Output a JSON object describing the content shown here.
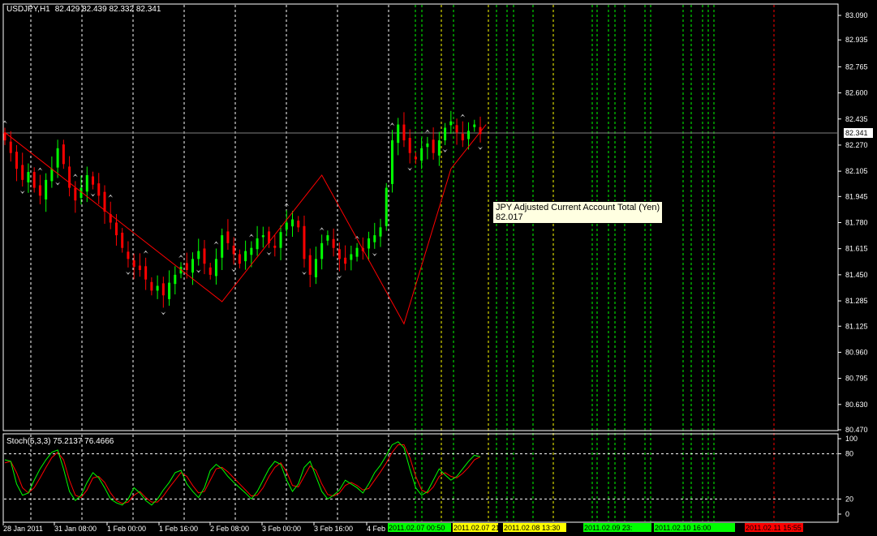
{
  "header": {
    "symbol": "USDJPY,H1",
    "ohlc": "82.429 82.439 82.332 82.341"
  },
  "stoch_header": "Stoch(5,3,3) 75.2137 76.4666",
  "current_price": "82.341",
  "tooltip": {
    "title": "JPY Adjusted Current Account Total (Yen)",
    "value": "82.017"
  },
  "colors": {
    "bull": "#00ff00",
    "bear": "#ff0000",
    "zigzag": "#ff0000",
    "stoch_main": "#00ff00",
    "stoch_signal": "#ff0000",
    "grid": "#ffffff",
    "frame": "#ffffff",
    "background": "#000000"
  },
  "chart_data": {
    "type": "line",
    "price_axis": {
      "labels": [
        "83.090",
        "82.935",
        "82.765",
        "82.600",
        "82.435",
        "82.270",
        "82.105",
        "81.945",
        "81.780",
        "81.615",
        "81.450",
        "81.285",
        "81.125",
        "80.960",
        "80.795",
        "80.630",
        "80.470"
      ],
      "ylim": [
        80.47,
        83.09
      ]
    },
    "stoch_axis": {
      "labels": [
        "100",
        "80",
        "20",
        "0"
      ],
      "ylim": [
        0,
        100
      ]
    },
    "time_labels": [
      "28 Jan 2011",
      "31 Jan 08:00",
      "1 Feb 00:00",
      "1 Feb 16:00",
      "2 Feb 08:00",
      "3 Feb 00:00",
      "3 Feb 16:00",
      "4 Feb"
    ],
    "close_series": [
      82.3,
      82.22,
      82.12,
      82.05,
      82.1,
      82.0,
      81.95,
      82.05,
      82.12,
      82.25,
      82.15,
      82.0,
      81.92,
      82.0,
      82.08,
      82.02,
      81.95,
      81.85,
      81.78,
      81.7,
      81.62,
      81.55,
      81.5,
      81.48,
      81.42,
      81.35,
      81.38,
      81.32,
      81.4,
      81.45,
      81.5,
      81.48,
      81.55,
      81.6,
      81.52,
      81.45,
      81.55,
      81.7,
      81.65,
      81.58,
      81.52,
      81.6,
      81.62,
      81.68,
      81.7,
      81.65,
      81.62,
      81.72,
      81.78,
      81.8,
      81.75,
      81.55,
      81.45,
      81.55,
      81.65,
      81.7,
      81.62,
      81.55,
      81.52,
      81.58,
      81.62,
      81.6,
      81.68,
      81.7,
      81.75,
      82.0,
      82.3,
      82.4,
      82.3,
      82.22,
      82.18,
      82.25,
      82.28,
      82.22,
      82.3,
      82.38,
      82.42,
      82.35,
      82.3,
      82.36,
      82.4,
      82.34
    ],
    "zigzag": [
      [
        0,
        82.35
      ],
      [
        37,
        81.28
      ],
      [
        54,
        82.08
      ],
      [
        68,
        81.14
      ],
      [
        76,
        82.12
      ],
      [
        82,
        82.4
      ]
    ],
    "event_labels": [
      {
        "text": "2011.02.07 00:50",
        "color": "#00ff00"
      },
      {
        "text": "2011.02.07 21:",
        "color": "#ffff00"
      },
      {
        "text": "2011.02.08 13:30",
        "color": "#ffff00"
      },
      {
        "text": "2011.02.09 23:",
        "color": "#00ff00"
      },
      {
        "text": "2011.02.10 16:00",
        "color": "#00ff00"
      },
      {
        "text": "2011.02.11 15:55",
        "color": "#ff0000"
      }
    ],
    "stoch_main": [
      72,
      70,
      40,
      25,
      28,
      45,
      60,
      72,
      82,
      85,
      60,
      30,
      18,
      25,
      42,
      55,
      48,
      35,
      20,
      15,
      12,
      20,
      35,
      28,
      18,
      12,
      20,
      32,
      42,
      55,
      58,
      40,
      30,
      22,
      35,
      58,
      66,
      60,
      50,
      42,
      35,
      28,
      20,
      30,
      45,
      60,
      70,
      66,
      45,
      30,
      40,
      62,
      70,
      50,
      30,
      20,
      25,
      32,
      45,
      40,
      35,
      28,
      40,
      55,
      65,
      78,
      92,
      96,
      88,
      60,
      35,
      25,
      30,
      45,
      60,
      52,
      45,
      50,
      60,
      70,
      78,
      76
    ],
    "stoch_signal": [
      68,
      70,
      55,
      35,
      28,
      35,
      48,
      62,
      75,
      82,
      72,
      45,
      25,
      22,
      32,
      48,
      50,
      42,
      28,
      18,
      14,
      16,
      25,
      30,
      22,
      16,
      16,
      24,
      35,
      45,
      55,
      50,
      38,
      28,
      30,
      45,
      60,
      62,
      56,
      48,
      40,
      32,
      24,
      25,
      35,
      50,
      62,
      68,
      56,
      38,
      36,
      50,
      64,
      58,
      40,
      26,
      24,
      28,
      38,
      42,
      38,
      32,
      34,
      45,
      56,
      68,
      82,
      92,
      92,
      75,
      50,
      32,
      28,
      36,
      50,
      55,
      50,
      48,
      54,
      62,
      72,
      76
    ]
  }
}
